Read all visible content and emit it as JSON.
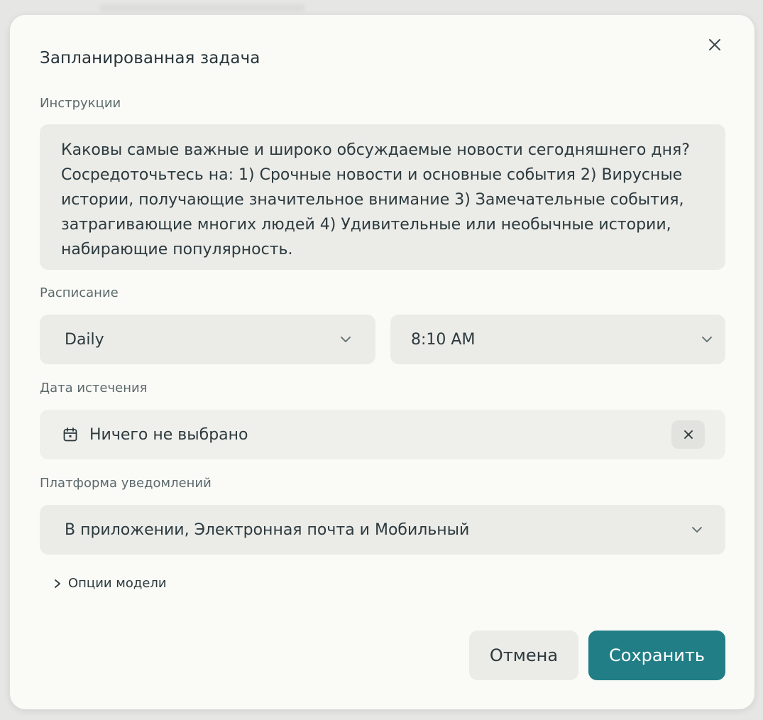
{
  "dialog": {
    "title": "Запланированная задача"
  },
  "instructions": {
    "label": "Инструкции",
    "text": "Каковы самые важные и широко обсуждаемые новости сегодняшнего дня? Сосредоточьтесь на: 1) Срочные новости и основные события 2) Вирусные истории, получающие значительное внимание 3) Замечательные события, затрагивающие многих людей 4) Удивительные или необычные истории, набирающие популярность."
  },
  "schedule": {
    "label": "Расписание",
    "frequency": "Daily",
    "time": "8:10 AM"
  },
  "expiration": {
    "label": "Дата истечения",
    "value": "Ничего не выбрано"
  },
  "notifications": {
    "label": "Платформа уведомлений",
    "value": "В приложении, Электронная почта и Мобильный"
  },
  "model_options": {
    "label": "Опции модели"
  },
  "actions": {
    "cancel_label": "Отмена",
    "save_label": "Сохранить"
  },
  "colors": {
    "accent": "#217e86",
    "field_bg": "#ebebe8",
    "dialog_bg": "#fafaf7"
  },
  "icons": [
    "close-icon",
    "chevron-down-icon",
    "calendar-icon",
    "chevron-right-icon"
  ]
}
